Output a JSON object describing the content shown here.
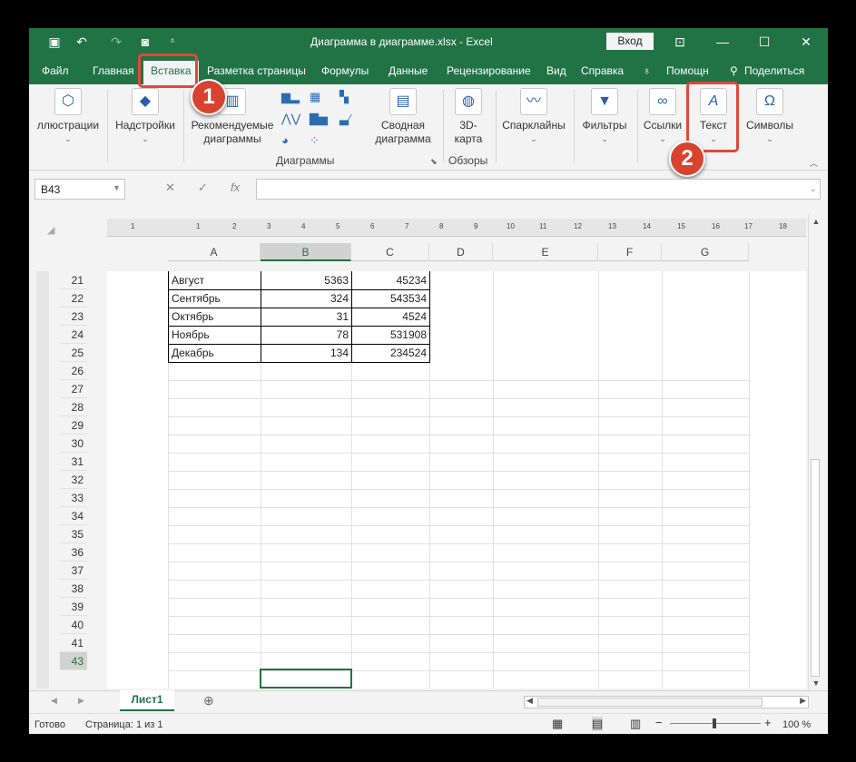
{
  "title_bar": {
    "window_title": "Диаграмма в диаграмме.xlsx  -  Excel",
    "login_label": "Вход",
    "icons": [
      "save-icon",
      "undo-icon",
      "redo-icon",
      "camera-icon",
      "customize-icon",
      "ribbon-display-icon",
      "minimize-icon",
      "maximize-icon",
      "close-icon"
    ]
  },
  "menu": {
    "items": [
      "Файл",
      "Главная",
      "Вставка",
      "Разметка страницы",
      "Формулы",
      "Данные",
      "Рецензирование",
      "Вид",
      "Справка"
    ],
    "help_search": "Помощн",
    "share": "Поделиться",
    "active": "Вставка"
  },
  "callouts": [
    "1",
    "2"
  ],
  "ribbon": {
    "illustrations": "ллюстрации",
    "addins": "Надстройки",
    "recommended_charts_line1": "Рекомендуемые",
    "recommended_charts_line2": "диаграммы",
    "pivot_chart_line1": "Сводная",
    "pivot_chart_line2": "диаграмма",
    "map3d_line1": "3D-",
    "map3d_line2": "карта",
    "sparklines": "Спарклайны",
    "filters": "Фильтры",
    "links": "Ссылки",
    "text": "Текст",
    "symbols": "Символы",
    "group_charts": "Диаграммы",
    "group_tours": "Обзоры"
  },
  "formula_bar": {
    "name_box": "B43",
    "fx": "fx",
    "cancel": "✕",
    "enter": "✓",
    "value": ""
  },
  "ruler_marks": [
    "1",
    "1",
    "2",
    "3",
    "4",
    "5",
    "6",
    "7",
    "8",
    "9",
    "10",
    "11",
    "12",
    "13",
    "14",
    "15",
    "16",
    "17",
    "18"
  ],
  "columns": [
    "A",
    "B",
    "C",
    "D",
    "E",
    "F",
    "G"
  ],
  "selected_column": "B",
  "rows": [
    "21",
    "22",
    "23",
    "24",
    "25",
    "26",
    "27",
    "28",
    "29",
    "30",
    "31",
    "32",
    "33",
    "34",
    "35",
    "36",
    "37",
    "38",
    "39",
    "40",
    "41",
    "43"
  ],
  "selected_row": "43",
  "table": [
    {
      "month": "Август",
      "b": "5363",
      "c": "45234"
    },
    {
      "month": "Сентябрь",
      "b": "324",
      "c": "543534"
    },
    {
      "month": "Октябрь",
      "b": "31",
      "c": "4524"
    },
    {
      "month": "Ноябрь",
      "b": "78",
      "c": "531908"
    },
    {
      "month": "Декабрь",
      "b": "134",
      "c": "234524"
    }
  ],
  "sheet_tabs": [
    "Лист1"
  ],
  "status_bar": {
    "ready": "Готово",
    "page": "Страница: 1 из 1",
    "zoom": "100 %"
  },
  "accent_color": "#217346",
  "callout_color": "#d8432f"
}
